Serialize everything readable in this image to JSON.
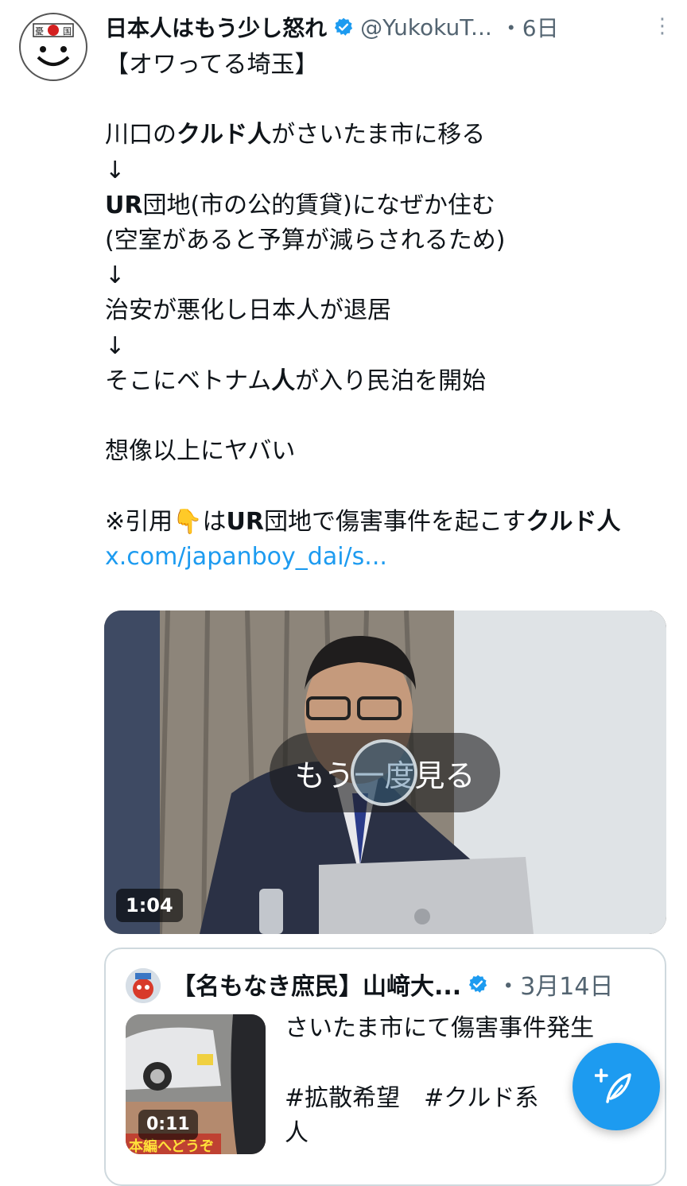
{
  "tweet": {
    "author_name": "日本人はもう少し怒れ",
    "handle": "@YukokuT...",
    "time": "・6日",
    "more_label": "⋮",
    "avatar_text": "憂国",
    "lines": {
      "l1": "【オワってる埼玉】",
      "l2a": "川口の",
      "l2b": "クルド人",
      "l2c": "がさいたま市に移る",
      "arrow": "↓",
      "l4a": "UR",
      "l4b": "団地(市の公的賃貸)になぜか住む",
      "l5": "(空室があると予算が減らされるため)",
      "l7": "治安が悪化し日本人が退居",
      "l9a": "そこにベトナム",
      "l9b": "人",
      "l9c": "が入り民泊を開始",
      "l11": "想像以上にヤバい",
      "l13a": "※引用",
      "l13emoji": "👇",
      "l13b": "は",
      "l13c": "UR",
      "l13d": "団地で傷害事件を起こす",
      "l13e": "クルド人"
    },
    "link": "x.com/japanboy_dai/s..."
  },
  "video": {
    "replay_label": "もう一度見る",
    "duration": "1:04"
  },
  "quote": {
    "author_name": "【名もなき庶民】山﨑大...",
    "time": "・3月14日",
    "text": "さいたま市にて傷害事件発生\n\n#拡散希望　#クルド系\n人",
    "thumb_duration": "0:11",
    "thumb_caption": "本編へどうぞ"
  },
  "colors": {
    "accent": "#1d9bf0",
    "secondary_text": "#536471"
  }
}
